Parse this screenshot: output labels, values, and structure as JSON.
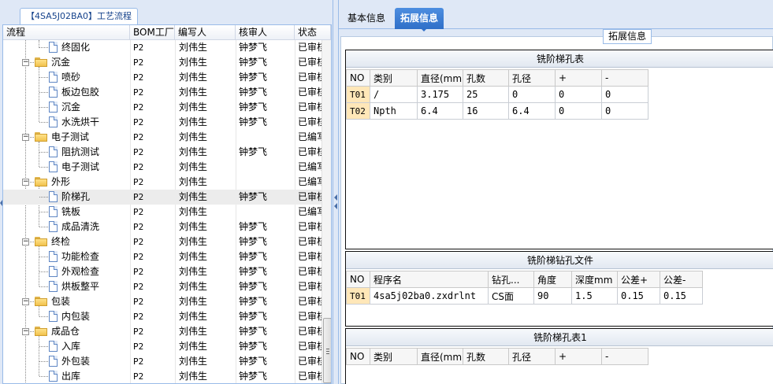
{
  "left": {
    "tab_label": "【4SA5J02BA0】工艺流程",
    "columns": [
      "流程",
      "BOM工厂",
      "编写人",
      "核审人",
      "状态"
    ],
    "rows": [
      {
        "kind": "leaf",
        "label": "终固化",
        "bom": "P2",
        "writer": "刘伟生",
        "reviewer": "钟梦飞",
        "status": "已审核"
      },
      {
        "kind": "group",
        "label": "沉金",
        "bom": "P2",
        "writer": "刘伟生",
        "reviewer": "钟梦飞",
        "status": "已审核"
      },
      {
        "kind": "leaf",
        "label": "喷砂",
        "bom": "P2",
        "writer": "刘伟生",
        "reviewer": "钟梦飞",
        "status": "已审核"
      },
      {
        "kind": "leaf",
        "label": "板边包胶",
        "bom": "P2",
        "writer": "刘伟生",
        "reviewer": "钟梦飞",
        "status": "已审核"
      },
      {
        "kind": "leaf",
        "label": "沉金",
        "bom": "P2",
        "writer": "刘伟生",
        "reviewer": "钟梦飞",
        "status": "已审核"
      },
      {
        "kind": "leaf",
        "label": "水洗烘干",
        "bom": "P2",
        "writer": "刘伟生",
        "reviewer": "钟梦飞",
        "status": "已审核"
      },
      {
        "kind": "group",
        "label": "电子测试",
        "bom": "P2",
        "writer": "刘伟生",
        "reviewer": "",
        "status": "已编写"
      },
      {
        "kind": "leaf",
        "label": "阻抗测试",
        "bom": "P2",
        "writer": "刘伟生",
        "reviewer": "钟梦飞",
        "status": "已审核"
      },
      {
        "kind": "leaf",
        "label": "电子测试",
        "bom": "P2",
        "writer": "刘伟生",
        "reviewer": "",
        "status": "已编写"
      },
      {
        "kind": "group",
        "label": "外形",
        "bom": "P2",
        "writer": "刘伟生",
        "reviewer": "",
        "status": "已编写"
      },
      {
        "kind": "leaf",
        "label": "阶梯孔",
        "bom": "P2",
        "writer": "刘伟生",
        "reviewer": "钟梦飞",
        "status": "已审核",
        "selected": true
      },
      {
        "kind": "leaf",
        "label": "铣板",
        "bom": "P2",
        "writer": "刘伟生",
        "reviewer": "",
        "status": "已编写"
      },
      {
        "kind": "leaf",
        "label": "成品清洗",
        "bom": "P2",
        "writer": "刘伟生",
        "reviewer": "钟梦飞",
        "status": "已审核"
      },
      {
        "kind": "group",
        "label": "终检",
        "bom": "P2",
        "writer": "刘伟生",
        "reviewer": "钟梦飞",
        "status": "已审核"
      },
      {
        "kind": "leaf",
        "label": "功能检查",
        "bom": "P2",
        "writer": "刘伟生",
        "reviewer": "钟梦飞",
        "status": "已审核"
      },
      {
        "kind": "leaf",
        "label": "外观检查",
        "bom": "P2",
        "writer": "刘伟生",
        "reviewer": "钟梦飞",
        "status": "已审核"
      },
      {
        "kind": "leaf",
        "label": "烘板整平",
        "bom": "P2",
        "writer": "刘伟生",
        "reviewer": "钟梦飞",
        "status": "已审核"
      },
      {
        "kind": "group",
        "label": "包装",
        "bom": "P2",
        "writer": "刘伟生",
        "reviewer": "钟梦飞",
        "status": "已审核"
      },
      {
        "kind": "leaf",
        "label": "内包装",
        "bom": "P2",
        "writer": "刘伟生",
        "reviewer": "钟梦飞",
        "status": "已审核"
      },
      {
        "kind": "group",
        "label": "成品仓",
        "bom": "P2",
        "writer": "刘伟生",
        "reviewer": "钟梦飞",
        "status": "已审核"
      },
      {
        "kind": "leaf",
        "label": "入库",
        "bom": "P2",
        "writer": "刘伟生",
        "reviewer": "钟梦飞",
        "status": "已审核"
      },
      {
        "kind": "leaf",
        "label": "外包装",
        "bom": "P2",
        "writer": "刘伟生",
        "reviewer": "钟梦飞",
        "status": "已审核"
      },
      {
        "kind": "leaf",
        "label": "出库",
        "bom": "P2",
        "writer": "刘伟生",
        "reviewer": "钟梦飞",
        "status": "已审核"
      }
    ]
  },
  "right": {
    "tabs": [
      "基本信息",
      "拓展信息"
    ],
    "active_tab": "拓展信息",
    "legend": "拓展信息",
    "sections": [
      {
        "title": "铣阶梯孔表",
        "headers": [
          "NO",
          "类别",
          "直径(mm)",
          "孔数",
          "孔径",
          "+",
          "-"
        ],
        "rows": [
          [
            "T01",
            "/",
            "3.175",
            "25",
            "0",
            "0",
            "0"
          ],
          [
            "T02",
            "Npth",
            "6.4",
            "16",
            "6.4",
            "0",
            "0"
          ]
        ]
      },
      {
        "title": "铣阶梯钻孔文件",
        "headers": [
          "NO",
          "程序名",
          "钻孔...",
          "角度",
          "深度mm",
          "公差+",
          "公差-"
        ],
        "rows": [
          [
            "T01",
            "4sa5j02ba0.zxdrlnt",
            "CS面",
            "90",
            "1.5",
            "0.15",
            "0.15"
          ]
        ]
      },
      {
        "title": "铣阶梯孔表1",
        "headers": [
          "NO",
          "类别",
          "直径(mm)",
          "孔数",
          "孔径",
          "+",
          "-"
        ],
        "rows": []
      }
    ]
  },
  "colors": {
    "panel_bg": "#dfe8f6",
    "border": "#99bbe8",
    "active_tab": "#2f6fc8",
    "no_header": "#ffd68a",
    "no_cell": "#ffe7b8",
    "folder": "#f1c24c"
  }
}
